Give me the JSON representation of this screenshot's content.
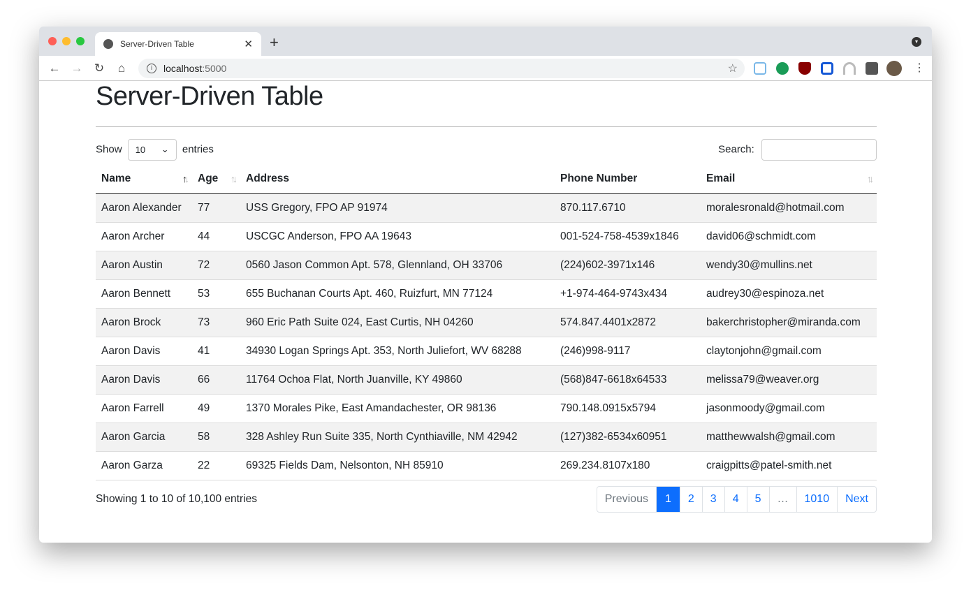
{
  "browser": {
    "tab_title": "Server-Driven Table",
    "url_host": "localhost",
    "url_port": ":5000"
  },
  "page": {
    "title": "Server-Driven Table",
    "show_label": "Show",
    "entries_label": "entries",
    "page_length": "10",
    "search_label": "Search:",
    "search_value": "",
    "info": "Showing 1 to 10 of 10,100 entries"
  },
  "table": {
    "columns": [
      "Name",
      "Age",
      "Address",
      "Phone Number",
      "Email"
    ],
    "rows": [
      [
        "Aaron Alexander",
        "77",
        "USS Gregory, FPO AP 91974",
        "870.117.6710",
        "moralesronald@hotmail.com"
      ],
      [
        "Aaron Archer",
        "44",
        "USCGC Anderson, FPO AA 19643",
        "001-524-758-4539x1846",
        "david06@schmidt.com"
      ],
      [
        "Aaron Austin",
        "72",
        "0560 Jason Common Apt. 578, Glennland, OH 33706",
        "(224)602-3971x146",
        "wendy30@mullins.net"
      ],
      [
        "Aaron Bennett",
        "53",
        "655 Buchanan Courts Apt. 460, Ruizfurt, MN 77124",
        "+1-974-464-9743x434",
        "audrey30@espinoza.net"
      ],
      [
        "Aaron Brock",
        "73",
        "960 Eric Path Suite 024, East Curtis, NH 04260",
        "574.847.4401x2872",
        "bakerchristopher@miranda.com"
      ],
      [
        "Aaron Davis",
        "41",
        "34930 Logan Springs Apt. 353, North Juliefort, WV 68288",
        "(246)998-9117",
        "claytonjohn@gmail.com"
      ],
      [
        "Aaron Davis",
        "66",
        "11764 Ochoa Flat, North Juanville, KY 49860",
        "(568)847-6618x64533",
        "melissa79@weaver.org"
      ],
      [
        "Aaron Farrell",
        "49",
        "1370 Morales Pike, East Amandachester, OR 98136",
        "790.148.0915x5794",
        "jasonmoody@gmail.com"
      ],
      [
        "Aaron Garcia",
        "58",
        "328 Ashley Run Suite 335, North Cynthiaville, NM 42942",
        "(127)382-6534x60951",
        "matthewwalsh@gmail.com"
      ],
      [
        "Aaron Garza",
        "22",
        "69325 Fields Dam, Nelsonton, NH 85910",
        "269.234.8107x180",
        "craigpitts@patel-smith.net"
      ]
    ]
  },
  "pagination": {
    "previous": "Previous",
    "pages": [
      "1",
      "2",
      "3",
      "4",
      "5"
    ],
    "ellipsis": "…",
    "last": "1010",
    "next": "Next",
    "current": "1"
  },
  "colors": {
    "accent": "#0d6efd"
  }
}
